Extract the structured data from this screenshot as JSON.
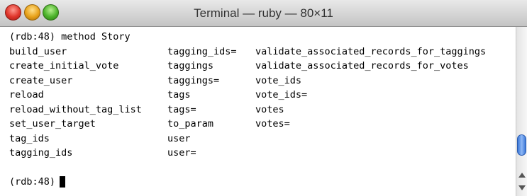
{
  "window": {
    "title": "Terminal — ruby — 80×11"
  },
  "terminal": {
    "prompt_line": "(rdb:48) method Story",
    "rows": [
      [
        "build_user",
        "tagging_ids=",
        "validate_associated_records_for_taggings"
      ],
      [
        "create_initial_vote",
        "taggings",
        "validate_associated_records_for_votes"
      ],
      [
        "create_user",
        "taggings=",
        "vote_ids"
      ],
      [
        "reload",
        "tags",
        "vote_ids="
      ],
      [
        "reload_without_tag_list",
        "tags=",
        "votes"
      ],
      [
        "set_user_target",
        "to_param",
        "votes="
      ],
      [
        "tag_ids",
        "user",
        ""
      ],
      [
        "tagging_ids",
        "user=",
        ""
      ]
    ],
    "current_prompt": "(rdb:48)"
  },
  "icons": {
    "close": "close-button-icon",
    "minimize": "minimize-button-icon",
    "zoom": "zoom-button-icon",
    "scroll_up": "scroll-up-arrow-icon",
    "scroll_down": "scroll-down-arrow-icon"
  }
}
